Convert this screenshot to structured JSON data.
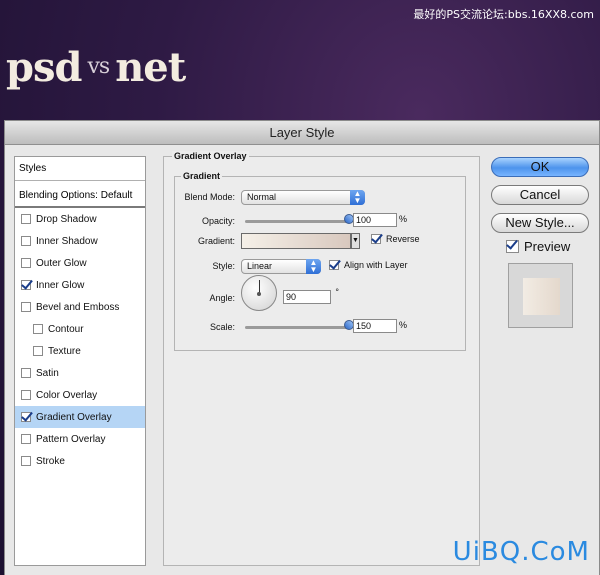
{
  "page": {
    "top_banner_text": "最好的PS交流论坛:bbs.16XX8.com",
    "logo": {
      "left": "psd",
      "middle": "vs",
      "right": "net"
    },
    "watermark": "UiBQ.CoM"
  },
  "dialog": {
    "title": "Layer Style",
    "styles_list": {
      "header": "Styles",
      "blending": "Blending Options: Default",
      "items": [
        {
          "label": "Drop Shadow",
          "checked": false
        },
        {
          "label": "Inner Shadow",
          "checked": false
        },
        {
          "label": "Outer Glow",
          "checked": false
        },
        {
          "label": "Inner Glow",
          "checked": true
        },
        {
          "label": "Bevel and Emboss",
          "checked": false
        },
        {
          "label": "Contour",
          "checked": false
        },
        {
          "label": "Texture",
          "checked": false
        },
        {
          "label": "Satin",
          "checked": false
        },
        {
          "label": "Color Overlay",
          "checked": false
        },
        {
          "label": "Gradient Overlay",
          "checked": true,
          "selected": true
        },
        {
          "label": "Pattern Overlay",
          "checked": false
        },
        {
          "label": "Stroke",
          "checked": false
        }
      ]
    },
    "gradient_overlay": {
      "group_title": "Gradient Overlay",
      "sub_title": "Gradient",
      "blend_mode_label": "Blend Mode:",
      "blend_mode_value": "Normal",
      "opacity_label": "Opacity:",
      "opacity_value": "100",
      "opacity_level": 1.0,
      "percent": "%",
      "gradient_label": "Gradient:",
      "reverse_label": "Reverse",
      "reverse_checked": true,
      "style_label": "Style:",
      "style_value": "Linear",
      "align_label": "Align with Layer",
      "align_checked": true,
      "angle_label": "Angle:",
      "angle_value": "90",
      "degree": "°",
      "scale_label": "Scale:",
      "scale_value": "150",
      "scale_level": 1.0
    },
    "buttons": {
      "ok": "OK",
      "cancel": "Cancel",
      "new_style": "New Style...",
      "preview_label": "Preview",
      "preview_checked": true
    },
    "colors": {
      "accent": "#4d93ec",
      "selected_row": "#b5d5f5",
      "gradient_start": "#f5f0e8",
      "gradient_end": "#d8c8be"
    }
  }
}
